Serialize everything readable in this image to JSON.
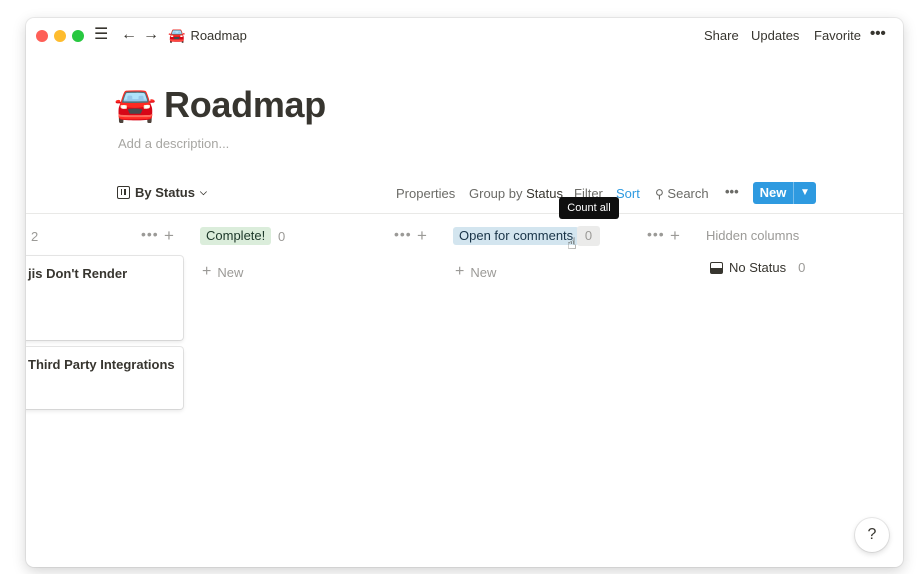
{
  "topbar": {
    "breadcrumb_emoji": "🚘",
    "breadcrumb_title": "Roadmap",
    "share": "Share",
    "updates": "Updates",
    "favorite": "Favorite",
    "more": "•••"
  },
  "page": {
    "emoji": "🚘",
    "title": "Roadmap",
    "description_placeholder": "Add a description..."
  },
  "toolbar": {
    "view": "By Status",
    "properties": "Properties",
    "group_by_prefix": "Group by",
    "group_by_value": "Status",
    "filter": "Filter",
    "sort": "Sort",
    "search": "Search",
    "more": "•••",
    "new": "New"
  },
  "tooltip": "Count all",
  "columns": [
    {
      "count": "2",
      "cards": [
        "jis Don't Render",
        "Third Party Integrations"
      ]
    },
    {
      "name": "Complete!",
      "count": "0",
      "add_label": "New"
    },
    {
      "name": "Open for comments",
      "count": "0",
      "add_label": "New"
    }
  ],
  "hidden": {
    "header": "Hidden columns",
    "items": [
      {
        "name": "No Status",
        "count": "0"
      }
    ]
  },
  "help": "?",
  "colors": {
    "accent": "#2e9ae0",
    "tag_green": "#dbeddb",
    "tag_blue": "#d3e5ef"
  }
}
